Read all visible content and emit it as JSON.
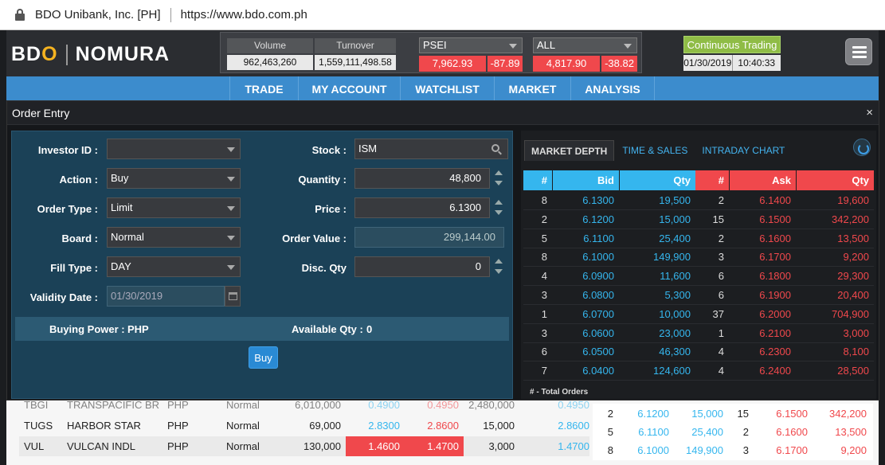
{
  "browser": {
    "site_name": "BDO Unibank, Inc. [PH]",
    "url": "https://www.bdo.com.ph"
  },
  "logo": {
    "part1_b": "BD",
    "part1_o": "O",
    "part2": "NOMURA"
  },
  "market": {
    "volume_label": "Volume",
    "volume": "962,463,260",
    "turnover_label": "Turnover",
    "turnover": "1,559,111,498.58",
    "index1": {
      "name": "PSEI",
      "value": "7,962.93",
      "change": "-87.89"
    },
    "index2": {
      "name": "ALL",
      "value": "4,817.90",
      "change": "-38.82"
    }
  },
  "trading": {
    "status": "Continuous Trading",
    "date": "01/30/2019",
    "time": "10:40:33"
  },
  "nav": [
    "TRADE",
    "MY ACCOUNT",
    "WATCHLIST",
    "MARKET",
    "ANALYSIS"
  ],
  "bg_rows": [
    [
      "TBGI",
      "TRANSPACIFIC BR",
      "PHP",
      "Normal",
      "6,010,000",
      "0.4900",
      "0.4950",
      "2,480,000",
      "0.4950"
    ],
    [
      "TUGS",
      "HARBOR STAR",
      "PHP",
      "Normal",
      "69,000",
      "2.8300",
      "2.8600",
      "15,000",
      "2.8600"
    ],
    [
      "VUL",
      "VULCAN INDL",
      "PHP",
      "Normal",
      "130,000",
      "1.4600",
      "1.4700",
      "3,000",
      "1.4700"
    ]
  ],
  "bg_depth": [
    [
      "2",
      "6.1200",
      "15,000",
      "15",
      "6.1500",
      "342,200"
    ],
    [
      "5",
      "6.1100",
      "25,400",
      "2",
      "6.1600",
      "13,500"
    ],
    [
      "8",
      "6.1000",
      "149,900",
      "3",
      "6.1700",
      "9,200"
    ]
  ],
  "modal": {
    "title": "Order Entry",
    "close": "×"
  },
  "form": {
    "investor_label": "Investor ID :",
    "investor_value": "",
    "action_label": "Action :",
    "action_value": "Buy",
    "order_type_label": "Order Type :",
    "order_type_value": "Limit",
    "board_label": "Board :",
    "board_value": "Normal",
    "fill_type_label": "Fill Type :",
    "fill_type_value": "DAY",
    "validity_label": "Validity Date :",
    "validity_value": "01/30/2019",
    "stock_label": "Stock :",
    "stock_value": "ISM",
    "quantity_label": "Quantity :",
    "quantity_value": "48,800",
    "price_label": "Price :",
    "price_value": "6.1300",
    "order_value_label": "Order Value :",
    "order_value_value": "299,144.00",
    "disc_qty_label": "Disc. Qty",
    "disc_qty_value": "0",
    "buying_power_label": "Buying Power :",
    "buying_power_value": "PHP",
    "available_qty_label": "Available Qty :",
    "available_qty_value": "0",
    "buy_button": "Buy"
  },
  "depth": {
    "tabs": [
      "MARKET DEPTH",
      "TIME & SALES",
      "INTRADAY CHART"
    ],
    "headers": [
      "#",
      "Bid",
      "Qty",
      "#",
      "Ask",
      "Qty"
    ],
    "rows": [
      [
        "8",
        "6.1300",
        "19,500",
        "2",
        "6.1400",
        "19,600"
      ],
      [
        "2",
        "6.1200",
        "15,000",
        "15",
        "6.1500",
        "342,200"
      ],
      [
        "5",
        "6.1100",
        "25,400",
        "2",
        "6.1600",
        "13,500"
      ],
      [
        "8",
        "6.1000",
        "149,900",
        "3",
        "6.1700",
        "9,200"
      ],
      [
        "4",
        "6.0900",
        "11,600",
        "6",
        "6.1800",
        "29,300"
      ],
      [
        "3",
        "6.0800",
        "5,300",
        "6",
        "6.1900",
        "20,400"
      ],
      [
        "1",
        "6.0700",
        "10,000",
        "37",
        "6.2000",
        "704,900"
      ],
      [
        "3",
        "6.0600",
        "23,000",
        "1",
        "6.2100",
        "3,000"
      ],
      [
        "6",
        "6.0500",
        "46,300",
        "4",
        "6.2300",
        "8,100"
      ],
      [
        "7",
        "6.0400",
        "124,600",
        "4",
        "6.2400",
        "28,500"
      ]
    ],
    "footer": "# - Total Orders"
  },
  "colors": {
    "bid": "#35b6ee",
    "ask": "#f0484c",
    "nav": "#3c8ccd",
    "form_bg": "#1b4157"
  }
}
